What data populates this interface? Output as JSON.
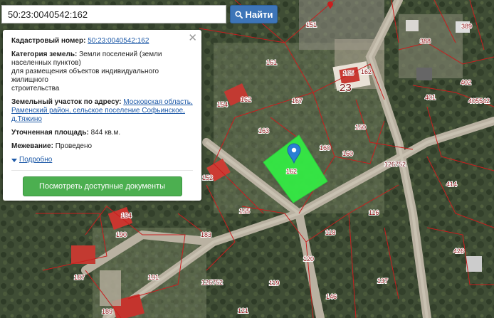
{
  "search": {
    "value": "50:23:0040542:162",
    "button_label": "Найти",
    "icon": "search-icon"
  },
  "popup": {
    "cadastral_label": "Кадастровый номер:",
    "cadastral_value": "50:23:0040542:162",
    "category_label": "Категория земель:",
    "category_value_line1": "Земли поселений (земли",
    "category_value_line2": "населенных пунктов)",
    "usage_line1": "для размещения объектов индивидуального жилищного",
    "usage_line2": "строительства",
    "address_label": "Земельный участок по адресу:",
    "address_line1": "Московская область,",
    "address_line2": "Раменский район, сельское поселение Софьинское,",
    "address_line3": "д.Тяжино",
    "area_label": "Уточненная площадь:",
    "area_value": "844 кв.м.",
    "survey_label": "Межевание:",
    "survey_value": "Проведено",
    "details_label": "Подробно",
    "docs_button": "Посмотреть доступные документы",
    "close_icon": "close-icon"
  },
  "map": {
    "selected_plot_label": "162",
    "plot_labels": [
      "151",
      "161",
      "165",
      "23",
      "167",
      "150",
      "154",
      "163",
      "160",
      "160",
      "152",
      "155",
      "116",
      "118",
      "183",
      "190",
      "120",
      "187",
      "191",
      "119",
      "137",
      "146",
      "189",
      "121",
      "389",
      "388",
      "402",
      "401",
      "405542",
      "414",
      "426",
      "162",
      "162",
      "162",
      "184"
    ],
    "road_labels": [
      "126752",
      "126752"
    ],
    "colors": {
      "selected_plot": "#33ee44",
      "boundary": "#c81e1e",
      "marker": "#2a7fd4"
    }
  }
}
